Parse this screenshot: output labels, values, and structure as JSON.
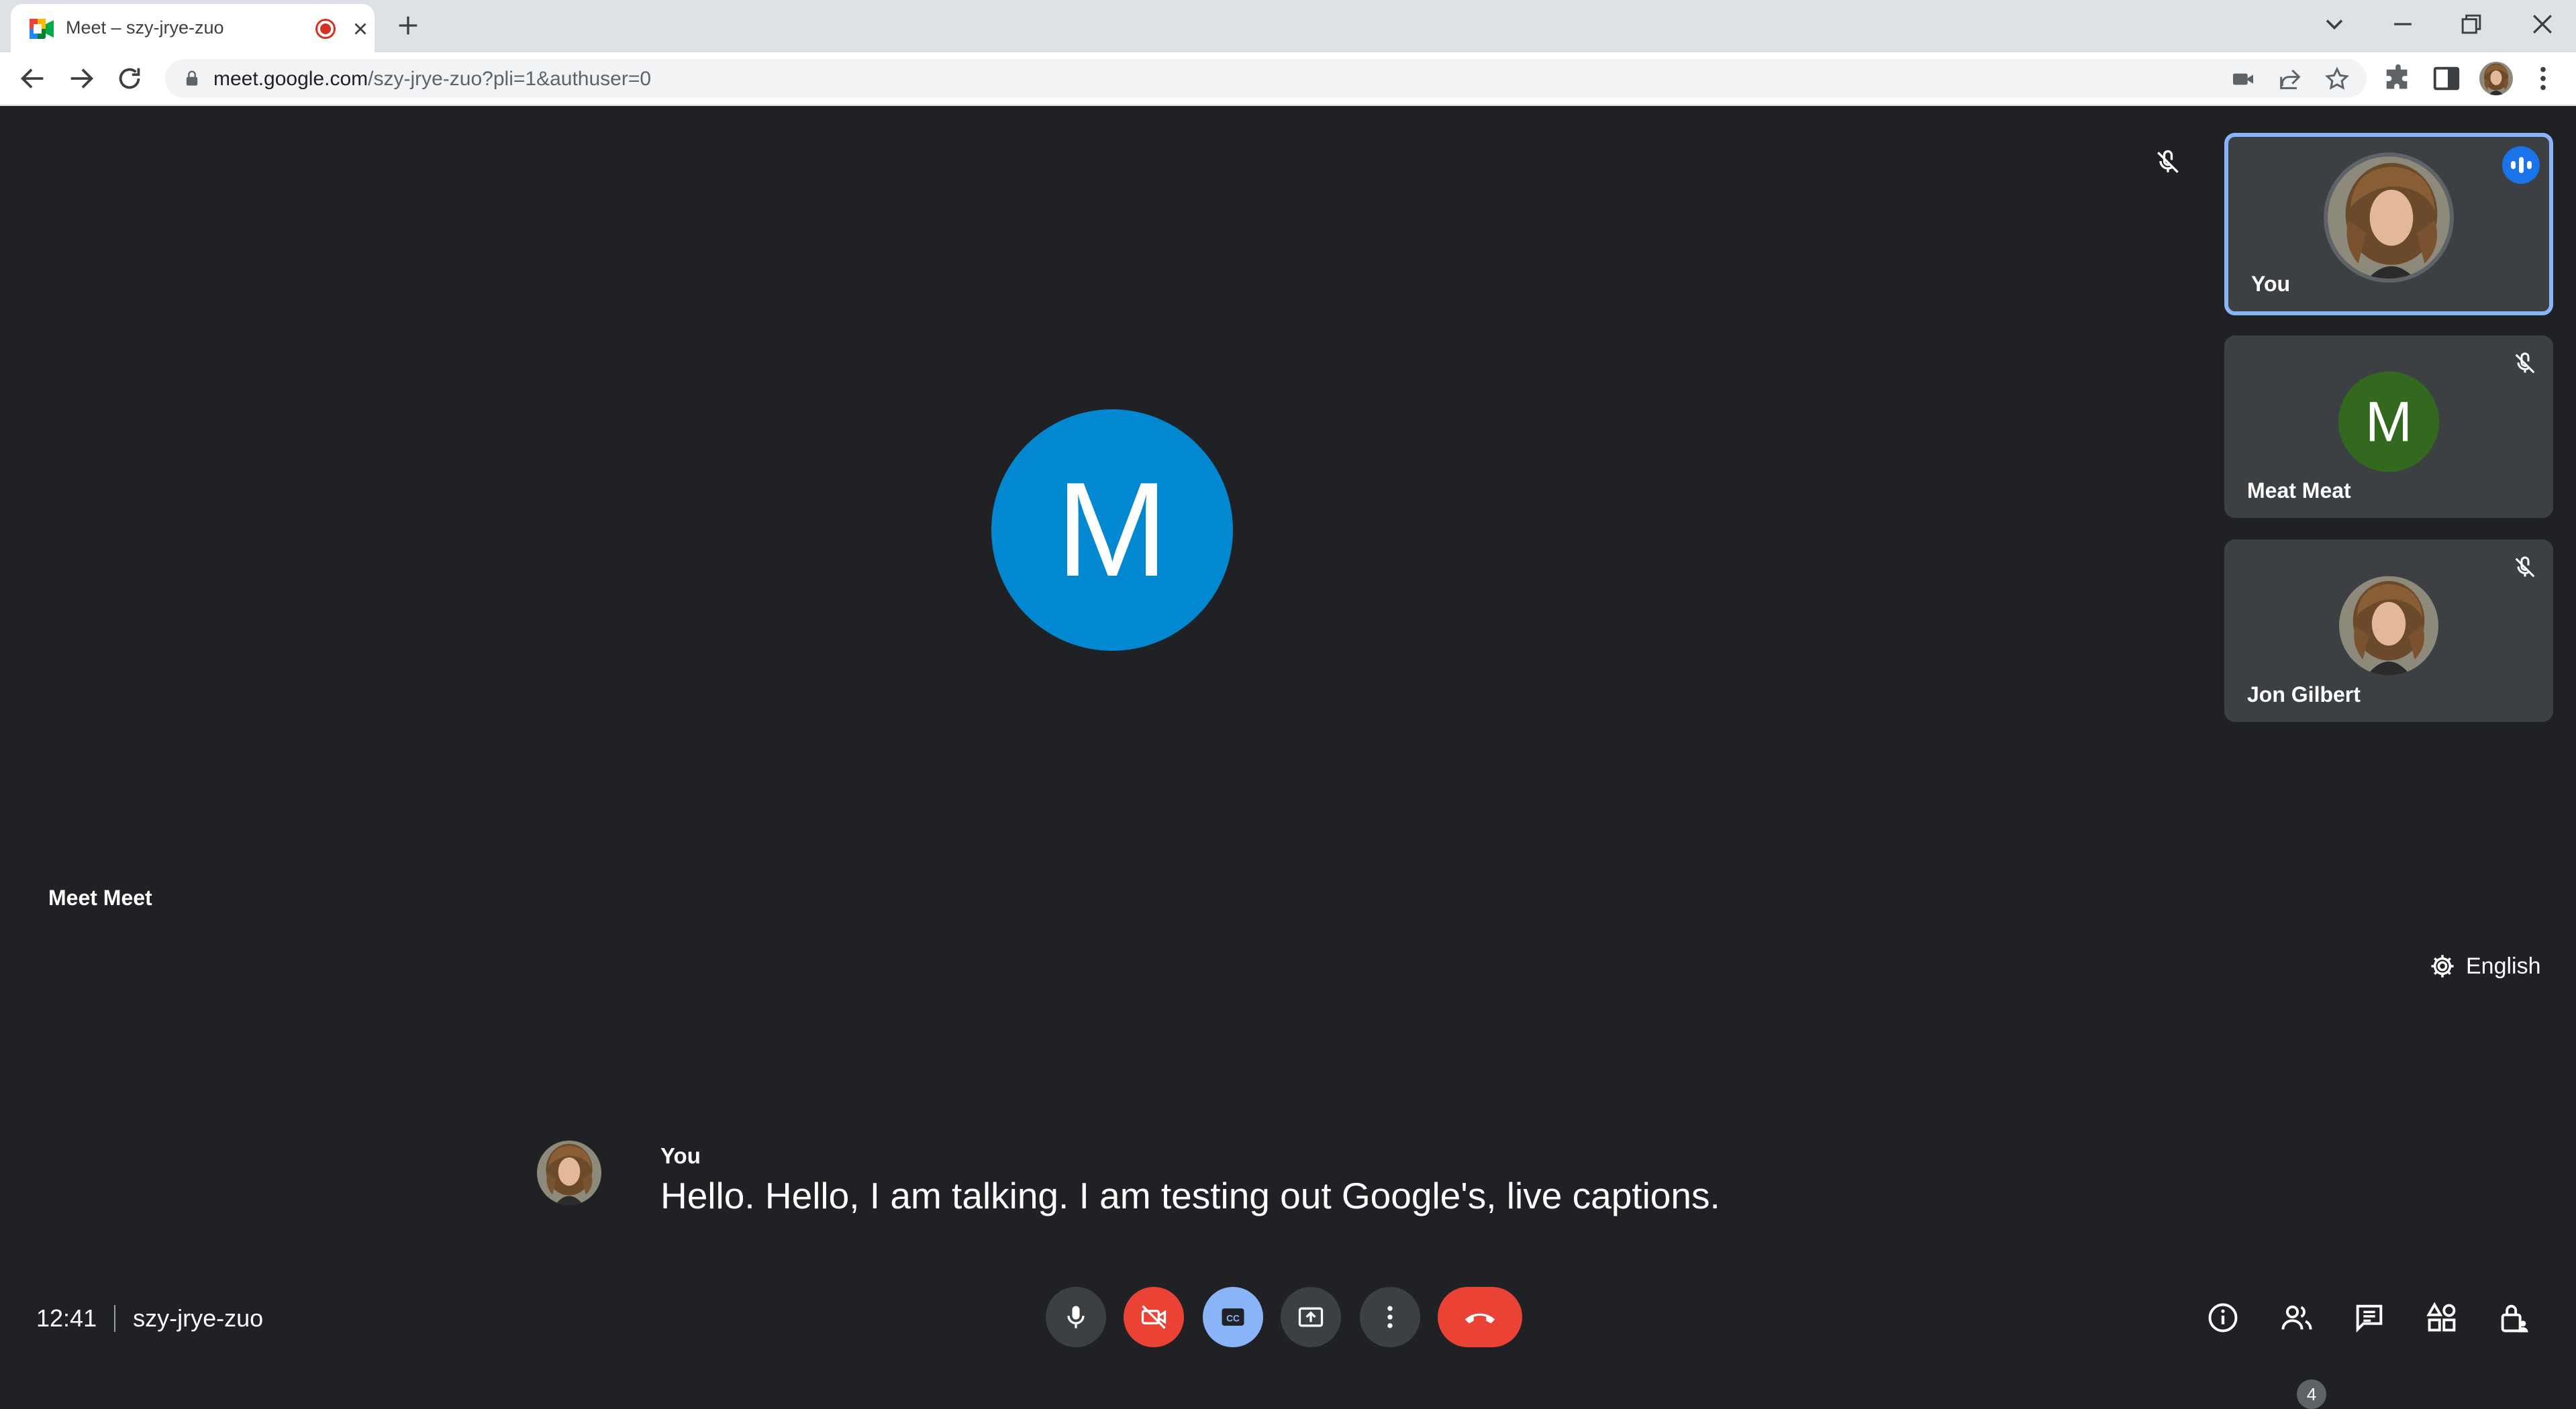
{
  "browser": {
    "tab_title": "Meet – szy-jrye-zuo",
    "url_host": "meet.google.com",
    "url_path": "/szy-jrye-zuo?pli=1&authuser=0"
  },
  "meeting": {
    "main_speaker_initial": "M",
    "main_speaker_name": "Meet Meet",
    "caption_language": "English",
    "time": "12:41",
    "meeting_code": "szy-jrye-zuo",
    "participant_count": "4"
  },
  "participants": [
    {
      "name": "You",
      "speaking": true
    },
    {
      "name": "Meat Meat",
      "initial": "M",
      "muted": true,
      "color": "#33691e"
    },
    {
      "name": "Jon Gilbert",
      "muted": true
    }
  ],
  "captions": {
    "speaker": "You",
    "text": "Hello. Hello, I am talking. I am testing out Google's, live captions."
  },
  "colors": {
    "background": "#202124",
    "main_avatar": "#0288d1",
    "end_call": "#ea4335",
    "captions_active": "#8ab4f8"
  }
}
